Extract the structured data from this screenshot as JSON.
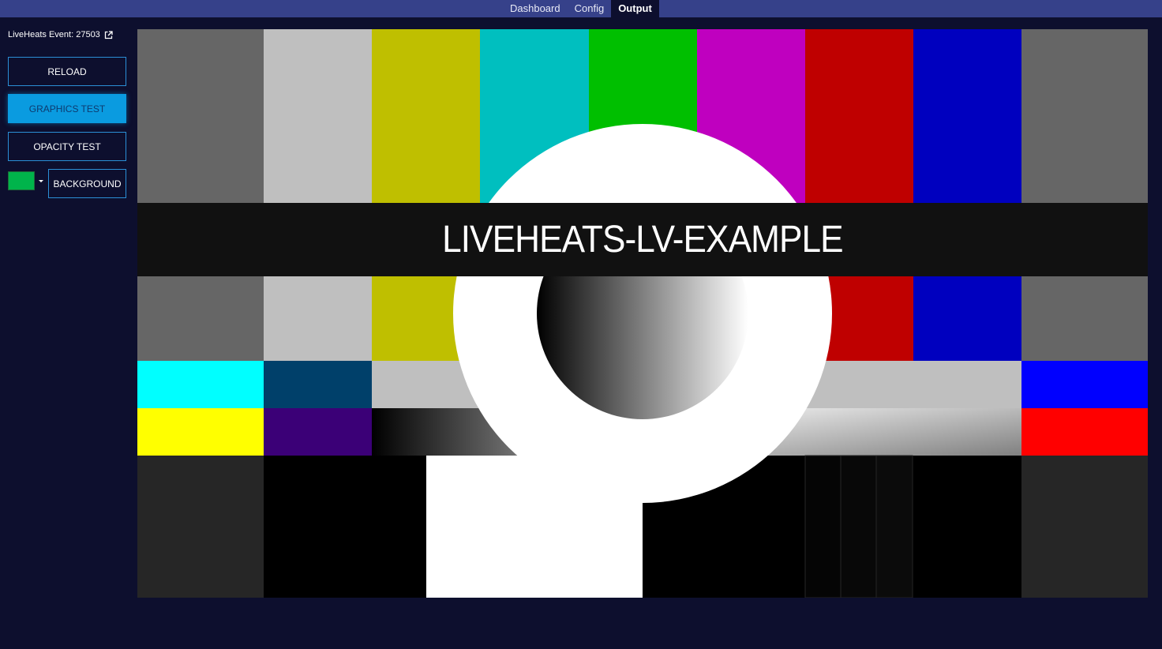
{
  "nav": {
    "tabs": [
      {
        "label": "Dashboard",
        "active": false
      },
      {
        "label": "Config",
        "active": false
      },
      {
        "label": "Output",
        "active": true
      }
    ]
  },
  "sidebar": {
    "event_label": "LiveHeats Event: 27503",
    "event_link_icon": "external-link-icon",
    "reload_label": "RELOAD",
    "graphics_test_label": "GRAPHICS TEST",
    "opacity_test_label": "OPACITY TEST",
    "background_label": "BACKGROUND",
    "background_color": "#00b44b"
  },
  "output": {
    "title": "LIVEHEATS-LV-EXAMPLE"
  },
  "colors": {
    "topbar": "#36418a",
    "page_bg": "#0d0f2e",
    "accent": "#0a9be0"
  }
}
